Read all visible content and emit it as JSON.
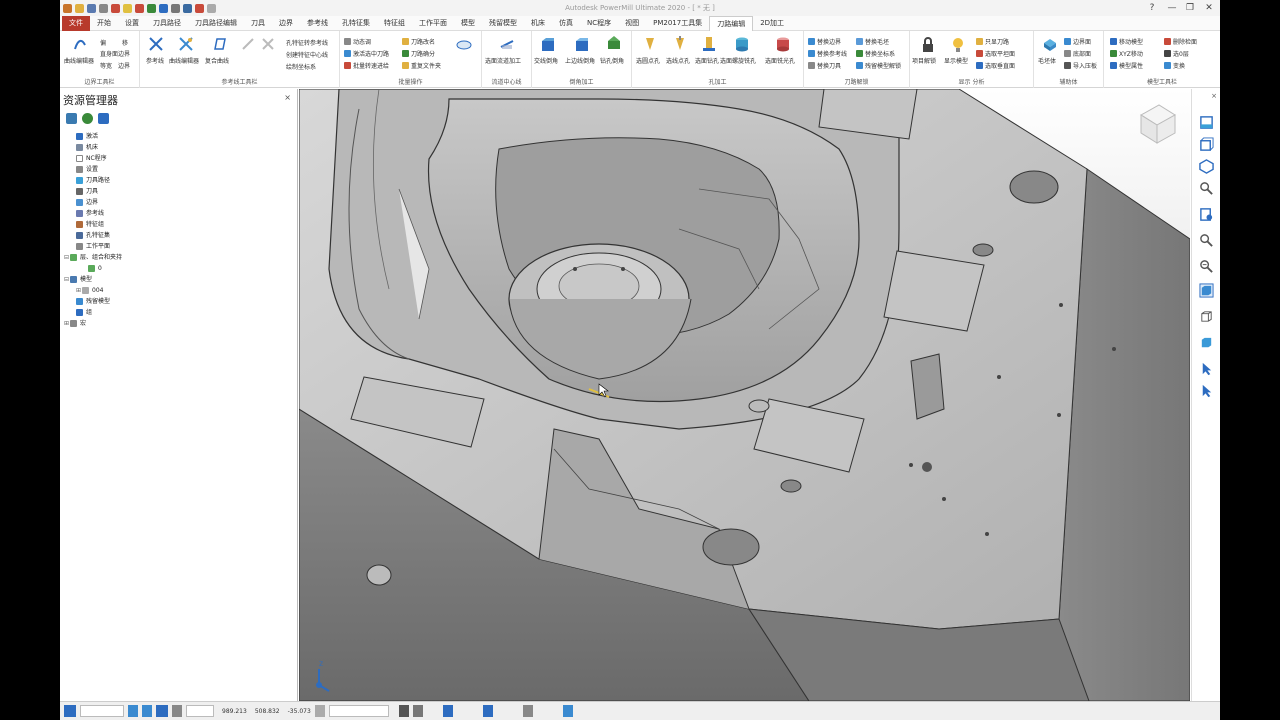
{
  "app": {
    "title": "Autodesk PowerMill Ultimate 2020 - [ * 无 ]"
  },
  "window_controls": {
    "help": "?",
    "minimize": "—",
    "restore": "❐",
    "close": "✕"
  },
  "menu": [
    {
      "label": "文件"
    },
    {
      "label": "开始"
    },
    {
      "label": "设置"
    },
    {
      "label": "刀具路径"
    },
    {
      "label": "刀具路径编辑"
    },
    {
      "label": "刀具"
    },
    {
      "label": "边界"
    },
    {
      "label": "参考线"
    },
    {
      "label": "孔特征集"
    },
    {
      "label": "特征组"
    },
    {
      "label": "工作平面"
    },
    {
      "label": "模型"
    },
    {
      "label": "残留模型"
    },
    {
      "label": "机床"
    },
    {
      "label": "仿真"
    },
    {
      "label": "NC程序"
    },
    {
      "label": "视图"
    },
    {
      "label": "PM2017工具集"
    },
    {
      "label": "刀路编辑"
    },
    {
      "label": "2D加工"
    }
  ],
  "ribbon": {
    "groups": [
      {
        "label": "边界工具栏",
        "items": [
          "曲线编辑器",
          "偏",
          "移",
          "直身面边界",
          "等宽",
          "边界"
        ]
      },
      {
        "label": "参考线工具栏",
        "items": [
          "参考线",
          "曲线编辑器",
          "复合曲线",
          "孔特征转参考线",
          "创建特征中心线",
          "绘制坐标系"
        ]
      },
      {
        "label": "批量操作",
        "items": [
          "动态调",
          "激活选中刀路",
          "批量转速进给",
          "刀路改名",
          "刀路确分",
          "重复文件夹"
        ]
      },
      {
        "label": "流道中心线",
        "items": [
          "选面流道加工"
        ]
      },
      {
        "label": "倒角加工",
        "items": [
          "交线倒角",
          "上边线倒角",
          "钻孔倒角"
        ]
      },
      {
        "label": "孔加工",
        "items": [
          "选圆点孔",
          "选线点孔",
          "选面钻孔",
          "选面螺旋铣孔",
          "选面铣光孔"
        ]
      },
      {
        "label": "刀路解锁",
        "items": [
          "替换边界",
          "替换参考线",
          "替换刀具",
          "替换毛坯",
          "替换坐标系",
          "残留模型解锁"
        ]
      },
      {
        "label": "显示 分析",
        "items": [
          "项目解锁",
          "显示模型",
          "只显刀路",
          "选取平坦面",
          "选取垂直面"
        ]
      },
      {
        "label": "辅助体",
        "items": [
          "毛坯体",
          "边界面",
          "底部面",
          "导入压板"
        ]
      },
      {
        "label": "模型工具栏",
        "items": [
          "移动模型",
          "XYZ移动",
          "模型属性",
          "删除检面",
          "选0层",
          "变换"
        ]
      }
    ]
  },
  "explorer": {
    "title": "资源管理器",
    "close": "×",
    "tree": [
      {
        "label": "激活",
        "expand": "",
        "indent": 1,
        "color": "#2d6cc0"
      },
      {
        "label": "机床",
        "expand": "",
        "indent": 1,
        "color": "#7a8aa0"
      },
      {
        "label": "NC程序",
        "expand": "",
        "indent": 1,
        "color": "#ffffff"
      },
      {
        "label": "设置",
        "expand": "",
        "indent": 1,
        "color": "#888888"
      },
      {
        "label": "刀具路径",
        "expand": "",
        "indent": 1,
        "color": "#3aa0d8"
      },
      {
        "label": "刀具",
        "expand": "",
        "indent": 1,
        "color": "#666666"
      },
      {
        "label": "边界",
        "expand": "",
        "indent": 1,
        "color": "#4a90d0"
      },
      {
        "label": "参考线",
        "expand": "",
        "indent": 1,
        "color": "#6a7ab0"
      },
      {
        "label": "特征组",
        "expand": "",
        "indent": 1,
        "color": "#b06a3a"
      },
      {
        "label": "孔特征集",
        "expand": "",
        "indent": 1,
        "color": "#4a6a9a"
      },
      {
        "label": "工作平面",
        "expand": "",
        "indent": 1,
        "color": "#888888"
      },
      {
        "label": "层、组合和夹持",
        "expand": "⊟",
        "indent": 0,
        "color": "#5aaa5a"
      },
      {
        "label": "0",
        "expand": "",
        "indent": 3,
        "color": "#5aaa5a"
      },
      {
        "label": "模型",
        "expand": "⊟",
        "indent": 0,
        "color": "#4a7ab0"
      },
      {
        "label": "004",
        "expand": "⊞",
        "indent": 2,
        "color": "#aaaaaa"
      },
      {
        "label": "残留模型",
        "expand": "",
        "indent": 1,
        "color": "#3a8ad0"
      },
      {
        "label": "组",
        "expand": "",
        "indent": 1,
        "color": "#2d6cc0"
      },
      {
        "label": "宏",
        "expand": "⊞",
        "indent": 0,
        "color": "#888888"
      }
    ]
  },
  "viewport": {
    "background_top": "#ffffff",
    "background_bottom": "#c8c8c8",
    "axis_label": "Z",
    "cursor": "pointer"
  },
  "rightbar": {
    "close": "×",
    "tools": [
      "view-iso-icon",
      "view-box-icon",
      "view-cube-icon",
      "zoom-rotate-icon",
      "refresh-icon",
      "zoom-box-icon",
      "zoom-out-icon",
      "shaded-icon",
      "wireframe-icon",
      "solid-blue-icon",
      "select-icon",
      "select-rotate-icon"
    ]
  },
  "status": {
    "x": "989.213",
    "y": "508.832",
    "z": "-35.073"
  }
}
